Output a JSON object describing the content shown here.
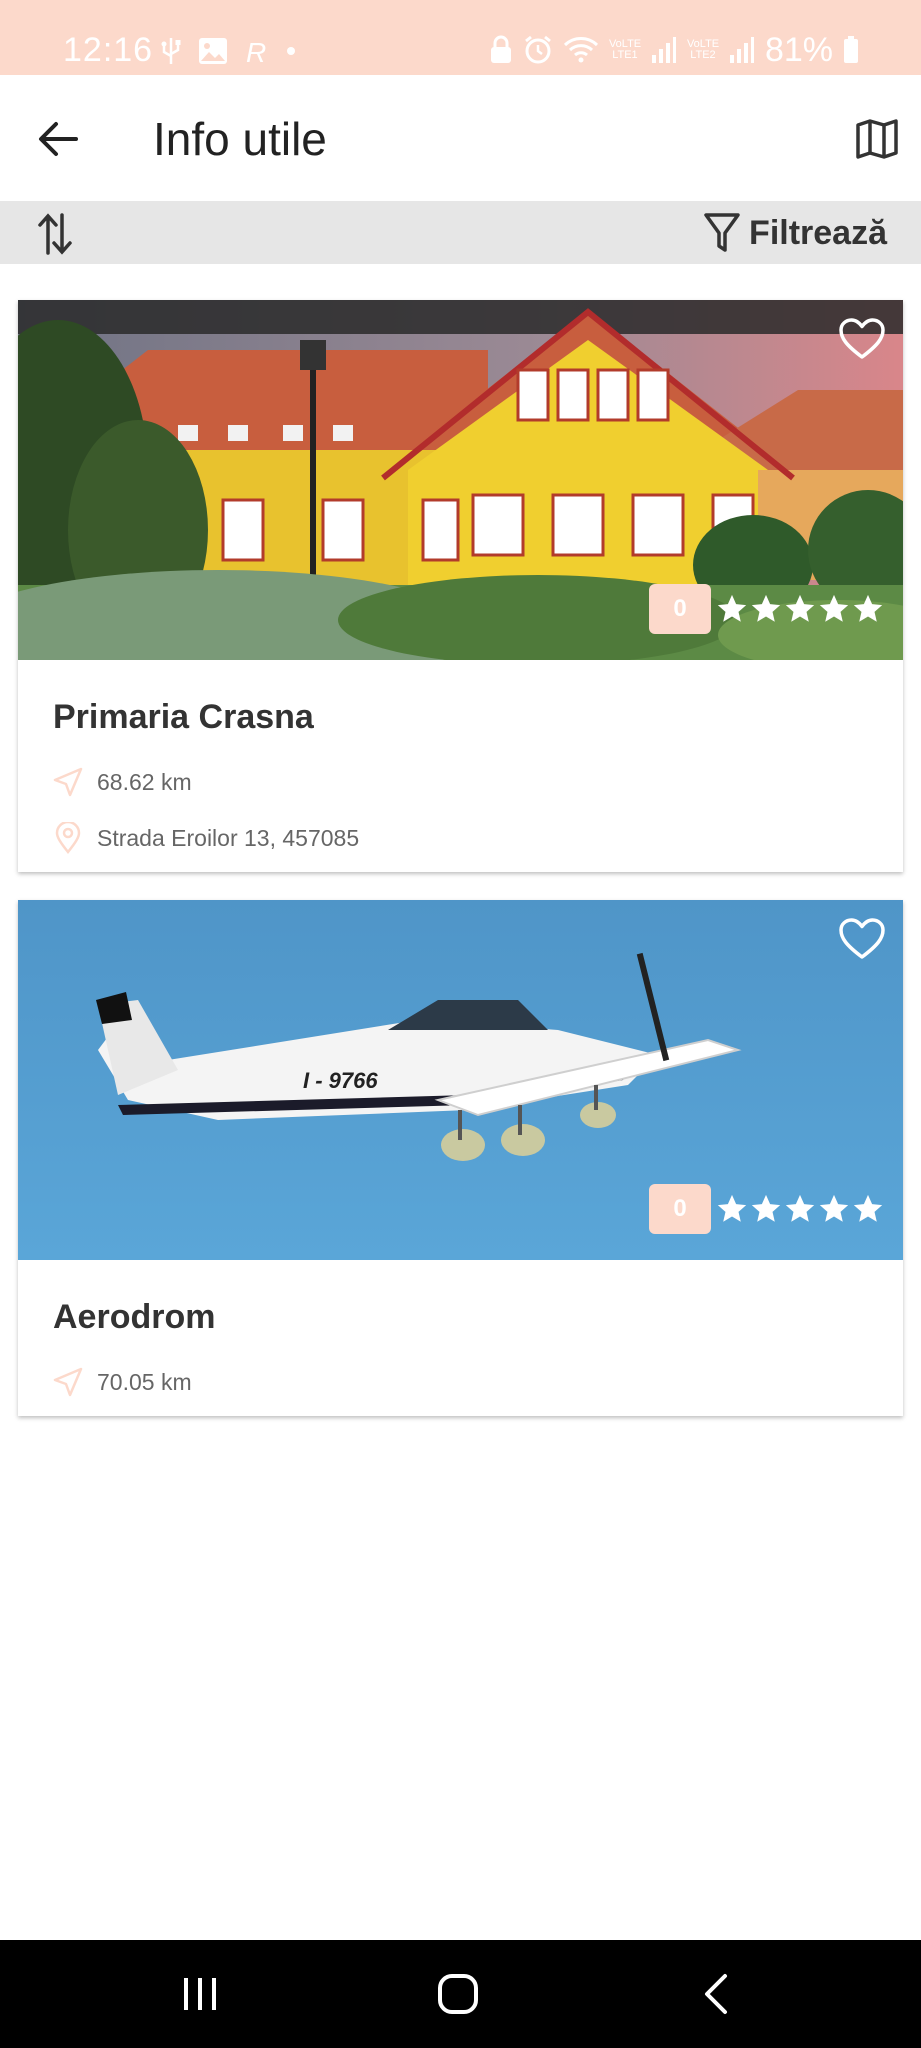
{
  "status_bar": {
    "time": "12:16",
    "network_1": "VoLTE LTE1",
    "network_2": "VoLTE LTE2",
    "battery": "81%"
  },
  "app_bar": {
    "title": "Info utile",
    "back_icon": "arrow-left-icon",
    "map_icon": "map-icon"
  },
  "toolbar": {
    "sort_icon": "sort-icon",
    "filter_icon": "filter-icon",
    "filter_label": "Filtrează"
  },
  "colors": {
    "accent": "#fcd9cb",
    "title_text": "#222222",
    "toolbar_bg": "#e6e6e6"
  },
  "places": [
    {
      "name": "Primaria Crasna",
      "rating": "0",
      "stars_filled": 0,
      "stars_total": 5,
      "distance": "68.62 km",
      "address": "Strada Eroilor 13, 457085",
      "image": "town-hall-photo"
    },
    {
      "name": "Aerodrom",
      "rating": "0",
      "stars_filled": 0,
      "stars_total": 5,
      "distance": "70.05 km",
      "address": "",
      "image": "airplane-photo"
    }
  ],
  "nav_bar": {
    "recents_icon": "recents-icon",
    "home_icon": "home-icon",
    "back_icon": "back-chevron-icon"
  }
}
